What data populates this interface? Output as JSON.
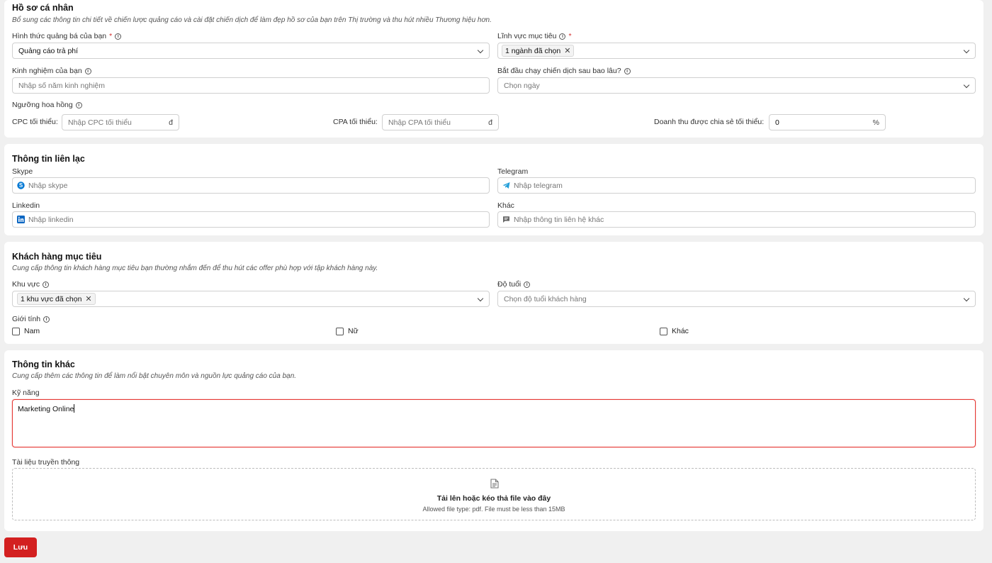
{
  "profile": {
    "title": "Hồ sơ cá nhân",
    "subtitle": "Bổ sung các thông tin chi tiết về chiến lược quảng cáo và cài đặt chiến dịch để làm đẹp hồ sơ của bạn trên Thị trường và thu hút nhiều Thương hiệu hơn.",
    "ad_form_label": "Hình thức quảng bá của bạn",
    "ad_form_value": "Quảng cáo trả phí",
    "target_field_label": "Lĩnh vực mục tiêu",
    "target_field_tag": "1 ngành đã chọn",
    "experience_label": "Kinh nghiệm của bạn",
    "experience_placeholder": "Nhập số năm kinh nghiệm",
    "start_label": "Bắt đầu chạy chiến dịch sau bao lâu?",
    "start_placeholder": "Chọn ngày",
    "commission_label": "Ngưỡng hoa hồng",
    "cpc_label": "CPC tối thiểu:",
    "cpc_placeholder": "Nhập CPC tối thiểu",
    "cpc_suffix": "đ",
    "cpa_label": "CPA tối thiểu:",
    "cpa_placeholder": "Nhập CPA tối thiểu",
    "cpa_suffix": "đ",
    "revenue_label": "Doanh thu được chia sẻ tối thiểu:",
    "revenue_value": "0",
    "revenue_suffix": "%"
  },
  "contact": {
    "title": "Thông tin liên lạc",
    "skype_label": "Skype",
    "skype_placeholder": "Nhập skype",
    "telegram_label": "Telegram",
    "telegram_placeholder": "Nhập telegram",
    "linkedin_label": "Linkedin",
    "linkedin_placeholder": "Nhập linkedin",
    "other_label": "Khác",
    "other_placeholder": "Nhập thông tin liên hệ khác"
  },
  "audience": {
    "title": "Khách hàng mục tiêu",
    "subtitle": "Cung cấp thông tin khách hàng mục tiêu bạn thường nhắm đến để thu hút các offer phù hợp với tập khách hàng này.",
    "region_label": "Khu vực",
    "region_tag": "1 khu vực đã chọn",
    "age_label": "Độ tuổi",
    "age_placeholder": "Chọn độ tuổi khách hàng",
    "gender_label": "Giới tính",
    "gender_options": [
      "Nam",
      "Nữ",
      "Khác"
    ]
  },
  "other": {
    "title": "Thông tin khác",
    "subtitle": "Cung cấp thêm các thông tin để làm nổi bật chuyên môn và nguồn lực quảng cáo của bạn.",
    "skills_label": "Kỹ năng",
    "skills_value": "Marketing Online",
    "media_label": "Tài liệu truyền thông",
    "upload_title": "Tải lên hoặc kéo thả file vào đây",
    "upload_note": "Allowed file type: pdf. File must be less than 15MB"
  },
  "actions": {
    "save_label": "Lưu"
  },
  "colors": {
    "accent": "#d32020",
    "skype": "#0078d4",
    "telegram": "#229ed9",
    "linkedin": "#0a66c2"
  },
  "icons": [
    "info-icon",
    "chevron-down-icon",
    "close-icon",
    "skype-icon",
    "telegram-icon",
    "linkedin-icon",
    "chat-icon",
    "file-icon"
  ]
}
